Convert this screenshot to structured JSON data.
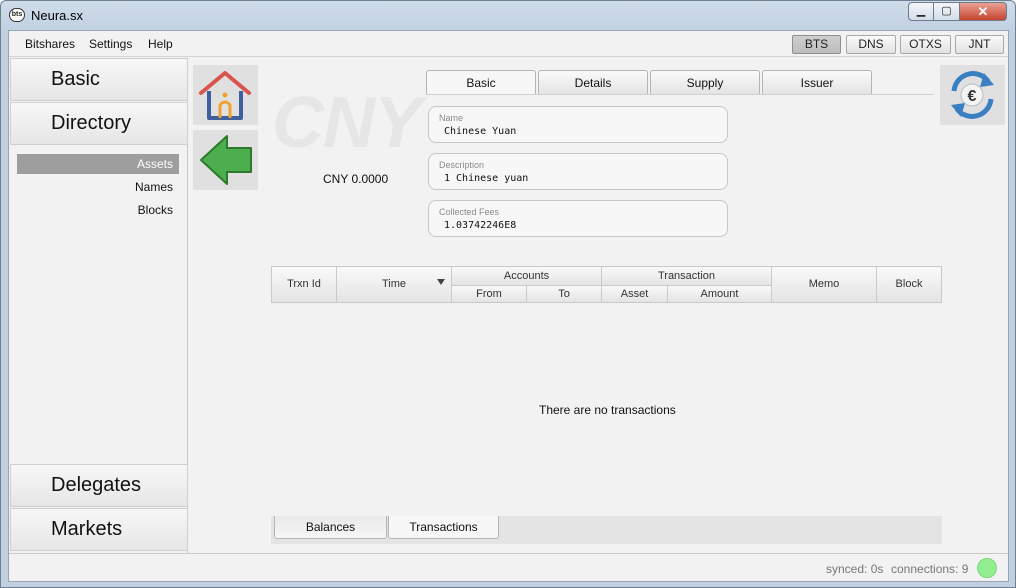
{
  "window": {
    "title": "Neura.sx",
    "app_icon": "bitshares-logo-icon"
  },
  "menu": {
    "items": [
      "Bitshares",
      "Settings",
      "Help"
    ]
  },
  "networks": [
    {
      "label": "BTS",
      "active": true
    },
    {
      "label": "DNS",
      "active": false
    },
    {
      "label": "OTXS",
      "active": false
    },
    {
      "label": "JNT",
      "active": false
    }
  ],
  "sidebar": {
    "basic": "Basic",
    "directory": "Directory",
    "sub_items": [
      {
        "label": "Assets",
        "selected": true
      },
      {
        "label": "Names",
        "selected": false
      },
      {
        "label": "Blocks",
        "selected": false
      }
    ],
    "delegates": "Delegates",
    "markets": "Markets"
  },
  "asset": {
    "symbol": "CNY",
    "balance": "CNY 0.0000"
  },
  "tabs": [
    "Basic",
    "Details",
    "Supply",
    "Issuer"
  ],
  "active_tab": "Basic",
  "fields": [
    {
      "label": "Name",
      "value": "Chinese Yuan"
    },
    {
      "label": "Description",
      "value": "1 Chinese yuan"
    },
    {
      "label": "Collected Fees",
      "value": "1.03742246E8"
    }
  ],
  "table": {
    "columns": {
      "trxn_id": "Trxn Id",
      "time": "Time",
      "accounts": "Accounts",
      "from": "From",
      "to": "To",
      "transaction": "Transaction",
      "asset": "Asset",
      "amount": "Amount",
      "memo": "Memo",
      "block": "Block"
    },
    "empty_message": "There are no transactions"
  },
  "bottom_tabs": [
    "Balances",
    "Transactions"
  ],
  "active_bottom_tab": "Transactions",
  "status": {
    "synced": "synced: 0s",
    "connections": "connections: 9",
    "indicator_color": "#90ee90"
  },
  "colors": {
    "home_roof": "#d9534f",
    "home_body": "#3f5f9f",
    "home_door": "#f0a030",
    "back_arrow": "#4cae4c",
    "currency_icon": "#3a7fc1"
  }
}
